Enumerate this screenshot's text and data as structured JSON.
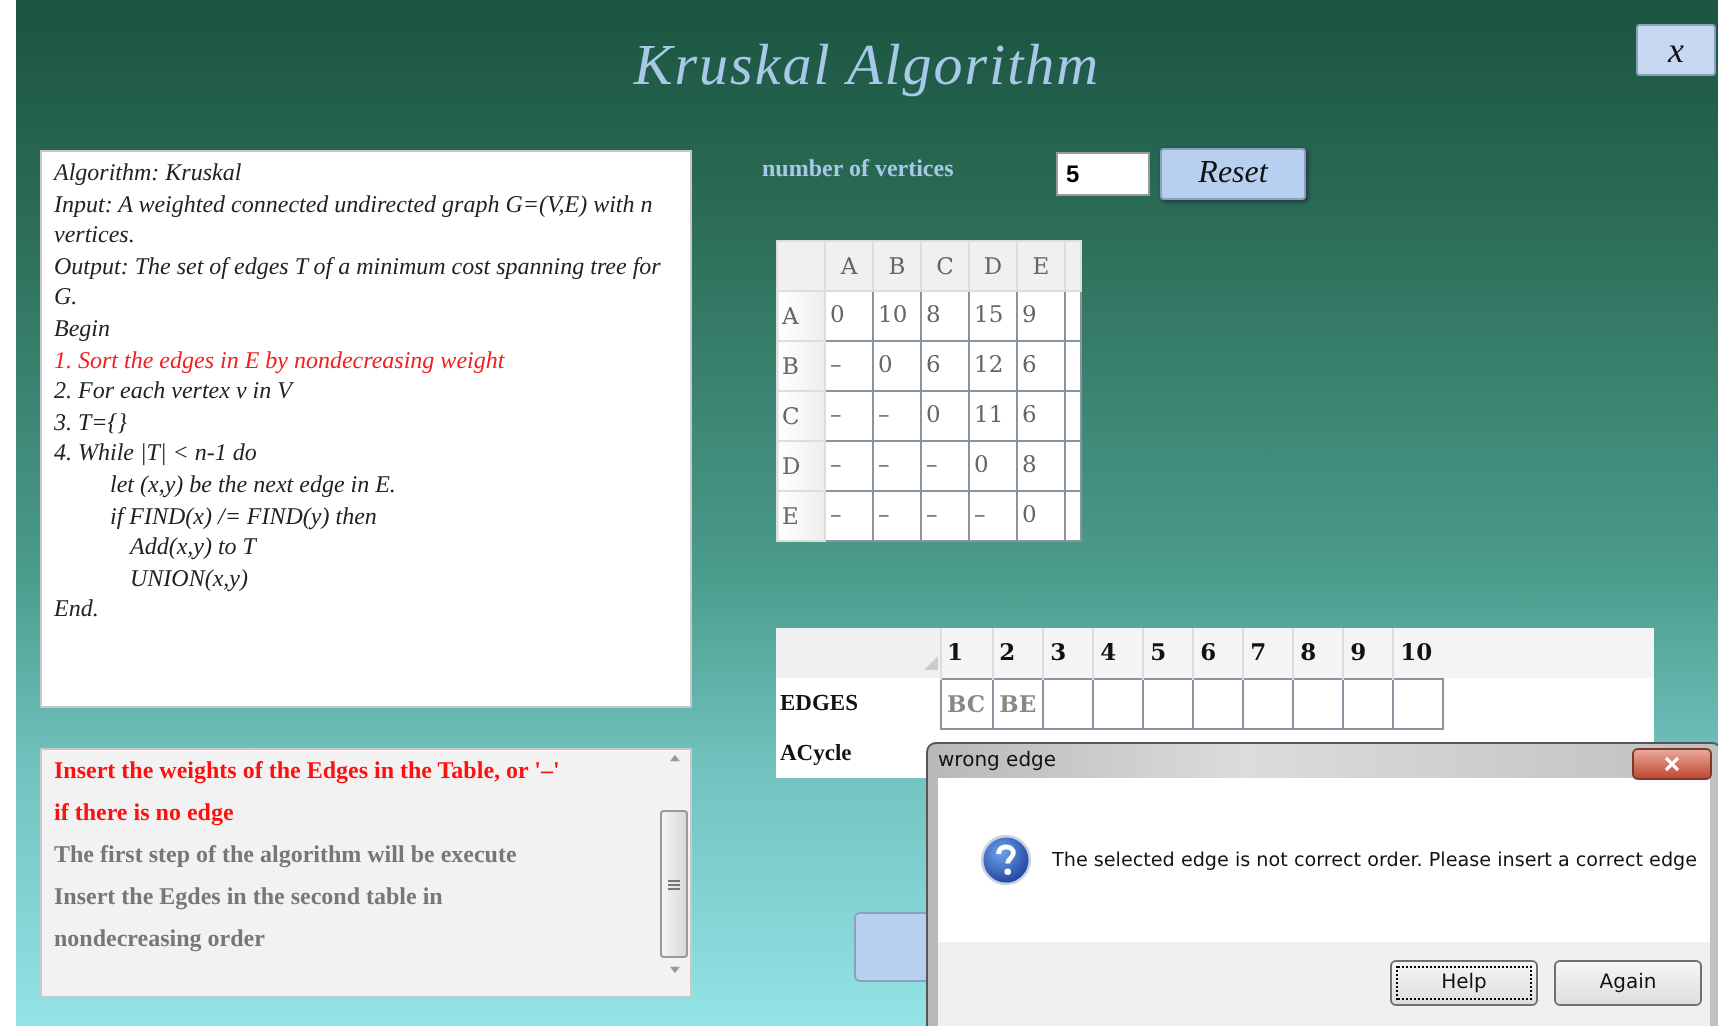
{
  "window": {
    "title": "Kruskal Algorithm",
    "close_label": "x"
  },
  "algorithm": {
    "lines": [
      {
        "text": "Algorithm: Kruskal",
        "highlighted": false
      },
      {
        "text": "Input: A weighted connected undirected graph G=(V,E) with n vertices.",
        "highlighted": false
      },
      {
        "text": "Output: The set of edges T of a minimum cost spanning tree for G.",
        "highlighted": false
      },
      {
        "text": "Begin",
        "highlighted": false
      },
      {
        "text": "1. Sort  the edges in E by nondecreasing weight",
        "highlighted": true
      },
      {
        "text": "2. For each vertex v in V",
        "highlighted": false
      },
      {
        "text": "3. T={}",
        "highlighted": false
      },
      {
        "text": "4. While |T| < n-1 do",
        "highlighted": false,
        "children": [
          {
            "text": "let (x,y) be the next edge in E.",
            "highlighted": false
          },
          {
            "text": "if FIND(x) /= FIND(y) then",
            "highlighted": false,
            "children": [
              {
                "text": "Add(x,y) to T",
                "highlighted": false
              },
              {
                "text": "UNION(x,y)",
                "highlighted": false
              }
            ]
          }
        ]
      },
      {
        "text": "End.",
        "highlighted": false
      }
    ]
  },
  "vertices": {
    "label": "number of vertices",
    "value": "5",
    "reset_button": "Reset"
  },
  "matrix": {
    "columns": [
      "A",
      "B",
      "C",
      "D",
      "E"
    ],
    "rows": [
      {
        "label": "A",
        "cells": [
          "0",
          "10",
          "8",
          "15",
          "9"
        ]
      },
      {
        "label": "B",
        "cells": [
          "–",
          "0",
          "6",
          "12",
          "6"
        ]
      },
      {
        "label": "C",
        "cells": [
          "–",
          "–",
          "0",
          "11",
          "6"
        ]
      },
      {
        "label": "D",
        "cells": [
          "–",
          "–",
          "–",
          "0",
          "8"
        ]
      },
      {
        "label": "E",
        "cells": [
          "–",
          "–",
          "–",
          "–",
          "0"
        ]
      }
    ]
  },
  "edges_table": {
    "columns": [
      "1",
      "2",
      "3",
      "4",
      "5",
      "6",
      "7",
      "8",
      "9",
      "10"
    ],
    "rows": [
      {
        "label": "EDGES",
        "cells": [
          "BC",
          "BE",
          "",
          "",
          "",
          "",
          "",
          "",
          "",
          ""
        ]
      },
      {
        "label": "ACycle",
        "cells": []
      }
    ]
  },
  "messages": [
    {
      "text": "Insert the weights of the Edges in the Table, or '–' if there is no edge",
      "highlighted": true
    },
    {
      "text": "The first step of the algorithm will be execute",
      "highlighted": false
    },
    {
      "text": "Insert the Egdes in the second table in nondecreasing order",
      "highlighted": false
    }
  ],
  "dialog": {
    "title": "wrong edge",
    "message": "The selected edge is not correct order. Please insert a correct edge",
    "buttons": [
      {
        "label": "Help",
        "focused": true
      },
      {
        "label": "Again",
        "focused": false
      }
    ]
  }
}
